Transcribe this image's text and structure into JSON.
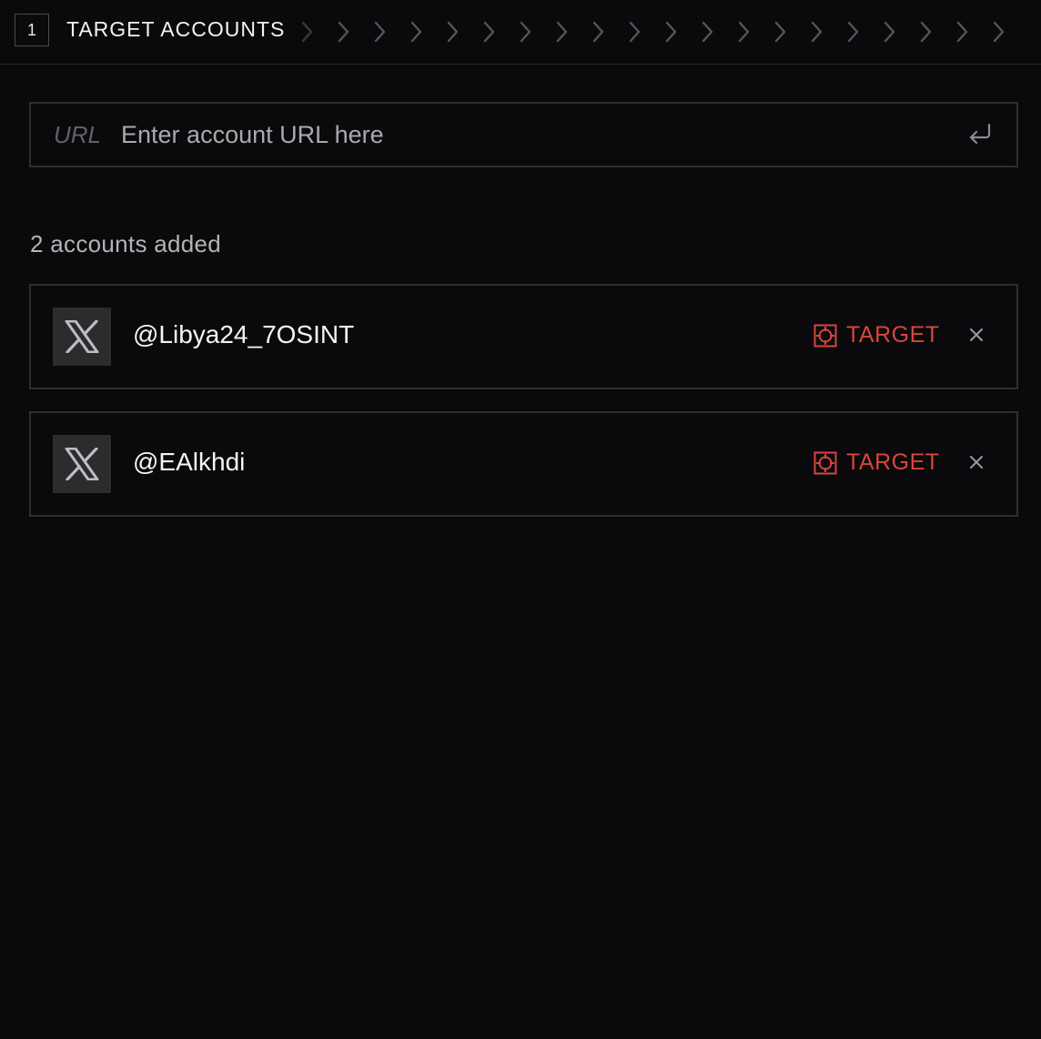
{
  "step": {
    "number": "1",
    "title": "TARGET ACCOUNTS",
    "chevron_count": 20
  },
  "url_field": {
    "prefix": "URL",
    "placeholder": "Enter account URL here",
    "value": "",
    "submit_icon": "enter-return-icon"
  },
  "accounts_summary": "2 accounts added",
  "accounts": [
    {
      "platform_icon": "x-logo-icon",
      "handle": "@Libya24_7OSINT",
      "target_label": "TARGET",
      "remove_icon": "close-icon"
    },
    {
      "platform_icon": "x-logo-icon",
      "handle": "@EAlkhdi",
      "target_label": "TARGET",
      "remove_icon": "close-icon"
    }
  ],
  "colors": {
    "background": "#0a0a0c",
    "border": "#2e2e32",
    "accent_target": "#d8453b",
    "avatar_bg": "#2c2c2f"
  }
}
